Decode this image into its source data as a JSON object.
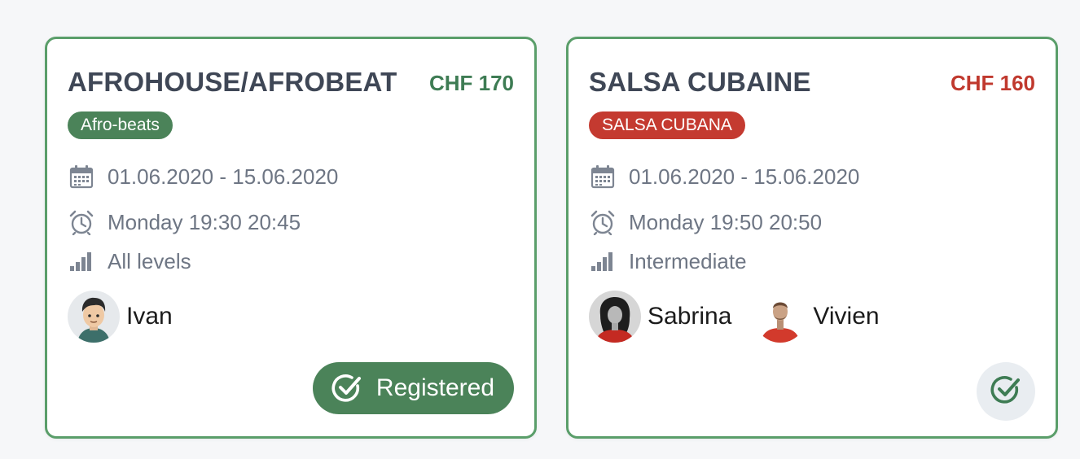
{
  "cards": [
    {
      "title": "AFROHOUSE/AFROBEAT",
      "price": "CHF 170",
      "tag": "Afro-beats",
      "date_range": "01.06.2020 - 15.06.2020",
      "schedule": "Monday 19:30 20:45",
      "level": "All levels",
      "teachers": [
        {
          "name": "Ivan"
        }
      ],
      "register": {
        "label": "Registered",
        "icon": "check-circle-icon"
      },
      "accent_color": "#3e7c54"
    },
    {
      "title": "SALSA CUBAINE",
      "price": "CHF 160",
      "tag": "SALSA CUBANA",
      "date_range": "01.06.2020 - 15.06.2020",
      "schedule": "Monday 19:50 20:50",
      "level": "Intermediate",
      "teachers": [
        {
          "name": "Sabrina"
        },
        {
          "name": "Vivien"
        }
      ],
      "register": {
        "icon": "check-circle-icon"
      },
      "accent_color": "#c0392e"
    }
  ],
  "icons": {
    "date": "calendar-icon",
    "time": "alarm-clock-icon",
    "level": "signal-bars-icon"
  },
  "colors": {
    "card_border": "#5a9e6a",
    "green_tag": "#4b8359",
    "red_tag": "#c43a30",
    "text_muted": "#6e7684",
    "title_text": "#3f4756"
  }
}
